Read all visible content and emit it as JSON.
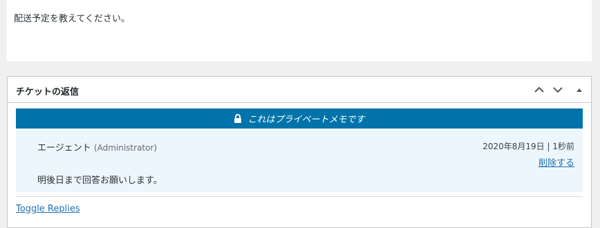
{
  "previous_message": {
    "text": "配送予定を教えてください。"
  },
  "metabox": {
    "title": "チケットの返信",
    "controls": [
      {
        "name": "move-up",
        "icon": "chevron-up-icon"
      },
      {
        "name": "move-down",
        "icon": "chevron-down-icon"
      },
      {
        "name": "toggle-panel",
        "icon": "triangle-up-icon"
      }
    ]
  },
  "private_note": {
    "banner": "これはプライベートメモです",
    "banner_icon": "lock-icon",
    "author_name": "エージェント",
    "author_role": "(Administrator)",
    "date": "2020年8月19日 | 1秒前",
    "delete_label": "削除する",
    "body": "明後日まで回答お願いします。"
  },
  "toggle_replies": "Toggle Replies",
  "colors": {
    "banner_bg": "#0073aa",
    "note_bg": "#eef6fd",
    "link": "#2271b1"
  }
}
